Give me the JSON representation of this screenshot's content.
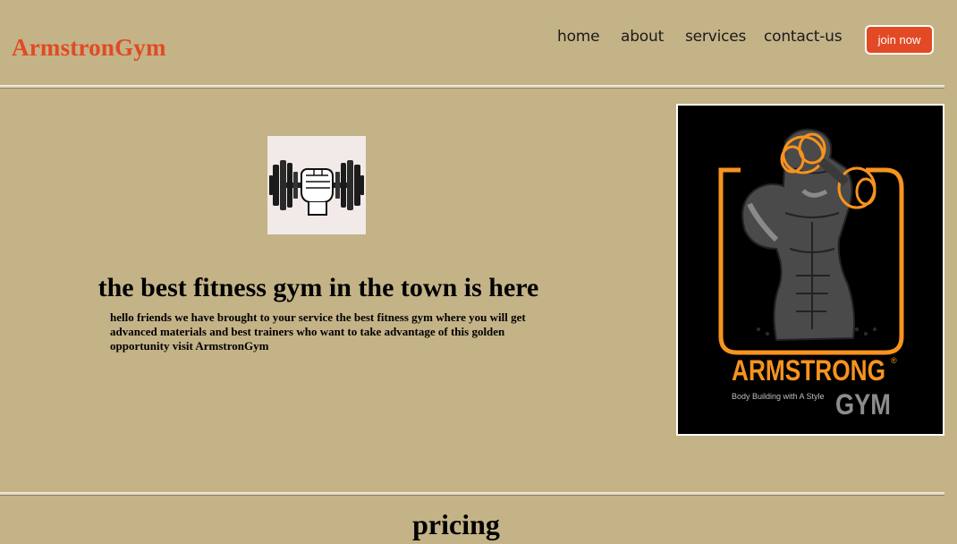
{
  "header": {
    "brand": "ArmstronGym",
    "nav": [
      {
        "label": "home"
      },
      {
        "label": "about"
      },
      {
        "label": "services"
      },
      {
        "label": "contact-us"
      }
    ],
    "join_label": "join now"
  },
  "hero": {
    "icon": "dumbbell-fist-icon",
    "title": "the best fitness gym in the town is here",
    "description": "hello friends we have brought to your service the best fitness gym where you will get advanced materials and best trainers who want to take advantage of this golden opportunity visit ArmstronGym"
  },
  "poster": {
    "brand": "ARMSTRONG",
    "registered": "®",
    "tagline": "Body Building with A Style",
    "gym": "GYM"
  },
  "pricing": {
    "title": "pricing"
  },
  "colors": {
    "background": "#c4b387",
    "accent": "#e14a25",
    "poster_orange": "#f7931e",
    "poster_grey": "#8c8c8c"
  }
}
